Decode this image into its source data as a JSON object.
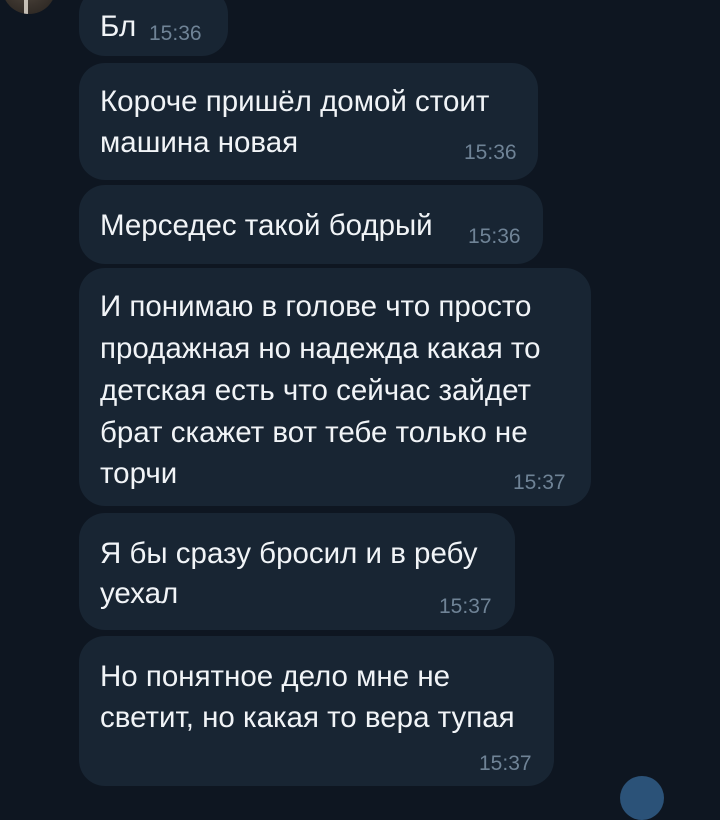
{
  "messages": [
    {
      "lines": [
        "Бл"
      ],
      "time": "15:36"
    },
    {
      "lines": [
        "Короче пришёл домой стоит",
        "машина новая"
      ],
      "time": "15:36"
    },
    {
      "lines": [
        "Мерседес такой бодрый"
      ],
      "time": "15:36"
    },
    {
      "lines": [
        "И понимаю в голове что просто",
        "продажная но надежда какая то",
        "детская есть что сейчас зайдет",
        "брат скажет вот тебе только не",
        "торчи"
      ],
      "time": "15:37"
    },
    {
      "lines": [
        "Я бы сразу бросил и в ребу",
        "уехал"
      ],
      "time": "15:37"
    },
    {
      "lines": [
        "Но понятное дело мне не",
        "светит, но какая то вера тупая"
      ],
      "time": "15:37"
    }
  ],
  "colors": {
    "background": "#0e1621",
    "bubble": "#182533",
    "text": "#f1f4f7",
    "time": "#6f8396"
  }
}
